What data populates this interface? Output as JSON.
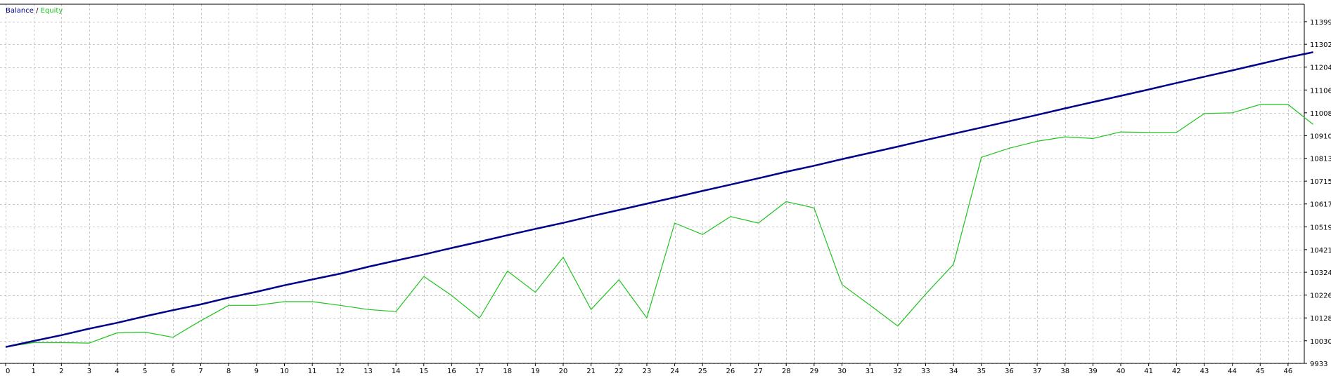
{
  "colors": {
    "background": "#ffffff",
    "grid": "#c8c8c8",
    "axis": "#000000",
    "balance": "#00008b",
    "equity": "#1fc41f"
  },
  "legend": {
    "balance_label": "Balance",
    "separator": " / ",
    "equity_label": "Equity"
  },
  "chart_data": {
    "type": "line",
    "xlabel": "",
    "ylabel": "",
    "xlim": [
      0,
      46.9
    ],
    "ylim": [
      9933,
      11474
    ],
    "grid": true,
    "legend_position": "top-left",
    "y_ticks": [
      9933,
      10030,
      10128,
      10226,
      10324,
      10421,
      10519,
      10617,
      10715,
      10813,
      10910,
      11008,
      11106,
      11204,
      11302,
      11399
    ],
    "x_ticks": [
      0,
      1,
      2,
      3,
      4,
      5,
      6,
      7,
      8,
      9,
      10,
      11,
      12,
      13,
      14,
      15,
      16,
      17,
      18,
      19,
      20,
      21,
      22,
      23,
      24,
      25,
      26,
      27,
      28,
      29,
      30,
      31,
      32,
      33,
      34,
      35,
      36,
      37,
      38,
      39,
      40,
      41,
      42,
      43,
      44,
      45,
      46
    ],
    "series": [
      {
        "name": "Balance",
        "x": [
          0,
          1,
          2,
          3,
          4,
          5,
          6,
          7,
          8,
          9,
          10,
          11,
          12,
          13,
          14,
          15,
          16,
          17,
          18,
          19,
          20,
          21,
          22,
          23,
          24,
          25,
          26,
          27,
          28,
          29,
          30,
          31,
          32,
          33,
          34,
          35,
          36,
          37,
          38,
          39,
          40,
          41,
          42,
          43,
          44,
          45,
          46,
          46.9
        ],
        "values": [
          10003,
          10029,
          10054,
          10082,
          10107,
          10135,
          10161,
          10186,
          10215,
          10240,
          10268,
          10293,
          10318,
          10347,
          10374,
          10400,
          10428,
          10455,
          10483,
          10510,
          10536,
          10564,
          10591,
          10618,
          10645,
          10673,
          10700,
          10727,
          10755,
          10781,
          10809,
          10836,
          10863,
          10891,
          10918,
          10945,
          10972,
          10999,
          11027,
          11054,
          11081,
          11108,
          11136,
          11163,
          11190,
          11218,
          11246,
          11268
        ]
      },
      {
        "name": "Equity",
        "x": [
          0,
          1,
          2,
          3,
          4,
          5,
          6,
          7,
          8,
          9,
          10,
          11,
          12,
          13,
          14,
          15,
          16,
          17,
          18,
          19,
          20,
          21,
          22,
          23,
          24,
          25,
          26,
          27,
          28,
          29,
          30,
          31,
          32,
          33,
          34,
          35,
          36,
          37,
          38,
          39,
          40,
          41,
          42,
          43,
          44,
          45,
          46,
          46.9
        ],
        "values": [
          10003,
          10022,
          10022,
          10020,
          10064,
          10067,
          10045,
          10116,
          10182,
          10182,
          10198,
          10198,
          10182,
          10164,
          10155,
          10306,
          10224,
          10127,
          10329,
          10238,
          10388,
          10164,
          10292,
          10128,
          10535,
          10486,
          10563,
          10535,
          10627,
          10600,
          10271,
          10183,
          10093,
          10230,
          10358,
          10817,
          10856,
          10886,
          10905,
          10898,
          10926,
          10924,
          10924,
          11005,
          11008,
          11044,
          11044,
          10958
        ]
      }
    ]
  }
}
